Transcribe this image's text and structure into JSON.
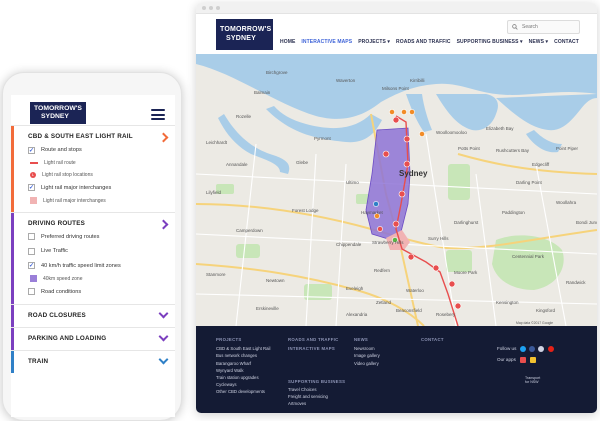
{
  "desktop": {
    "logo": {
      "line1": "TOMORROW'S",
      "line2": "SYDNEY"
    },
    "search_placeholder": "Search",
    "nav": [
      {
        "label": "HOME"
      },
      {
        "label": "INTERACTIVE MAPS",
        "active": true
      },
      {
        "label": "PROJECTS ▾"
      },
      {
        "label": "ROADS AND TRAFFIC"
      },
      {
        "label": "SUPPORTING BUSINESS ▾"
      },
      {
        "label": "NEWS ▾"
      },
      {
        "label": "CONTACT"
      }
    ],
    "map": {
      "city_label": "Sydney",
      "places": [
        "Birchgrove",
        "Balmain",
        "Rozelle",
        "Annandale",
        "Glebe",
        "Forest Lodge",
        "Camperdown",
        "Chippendale",
        "Newtown",
        "Erskineville",
        "Alexandria",
        "Redfern",
        "Waterloo",
        "Surry Hills",
        "Darlinghurst",
        "Paddington",
        "Potts Point",
        "Rushcutters Bay",
        "Woolloomooloo",
        "Elizabeth Bay",
        "Edgecliff",
        "Centennial Park",
        "Moore Park",
        "Zetland",
        "Kensington",
        "Kingsford",
        "Strawberry Hills",
        "Pyrmont",
        "Ultimo",
        "Haymarket",
        "Kirribilli",
        "Milsons Point",
        "Waverton",
        "Darling Point",
        "Point Piper",
        "Woollahra",
        "Bondi Junction",
        "Eveleigh",
        "Beaconsfield",
        "Rosebery",
        "Randwick",
        "Leichhardt",
        "Lilyfield",
        "Stanmore"
      ],
      "attribution": "Map data ©2017 Google"
    },
    "footer": {
      "projects_heading": "PROJECTS",
      "projects": [
        "CBD & South East Light Rail",
        "Bus network changes",
        "Barangaroo Wharf",
        "Wynyard Walk",
        "Train station upgrades",
        "Cycleways",
        "Other CBD developments"
      ],
      "roads_heading": "ROADS AND TRAFFIC",
      "maps_heading": "INTERACTIVE MAPS",
      "support_heading": "SUPPORTING BUSINESS",
      "support": [
        "Travel Choices",
        "Freight and servicing",
        "Artmoves"
      ],
      "news_heading": "NEWS",
      "news": [
        "Newsroom",
        "Image gallery",
        "Video gallery"
      ],
      "contact_heading": "CONTACT",
      "follow_label": "Follow us",
      "apps_label": "Our apps",
      "nsw_line1": "Transport",
      "nsw_line2": "for NSW"
    }
  },
  "mobile": {
    "logo": {
      "line1": "TOMORROW'S",
      "line2": "SYDNEY"
    },
    "sections": {
      "light_rail": {
        "title": "CBD & South East Light Rail",
        "route_and_stops": "Route and stops",
        "route": "Light rail route",
        "stops": "Light rail stop locations",
        "interchanges": "Light rail major interchanges",
        "interchanges_legend": "Light rail major interchanges"
      },
      "driving": {
        "title": "Driving routes",
        "preferred": "Preferred driving routes",
        "live": "Live Traffic",
        "speed": "40 km/h traffic speed limit zones",
        "speed_legend": "40km speed zone",
        "road_conditions": "Road conditions"
      },
      "road_closures": "Road closures",
      "parking": "Parking and loading",
      "train": "Train"
    },
    "colors": {
      "orange": "#f26b3a",
      "purple": "#7b3fbf",
      "red": "#e84e4e",
      "blue": "#2f80c7"
    }
  }
}
